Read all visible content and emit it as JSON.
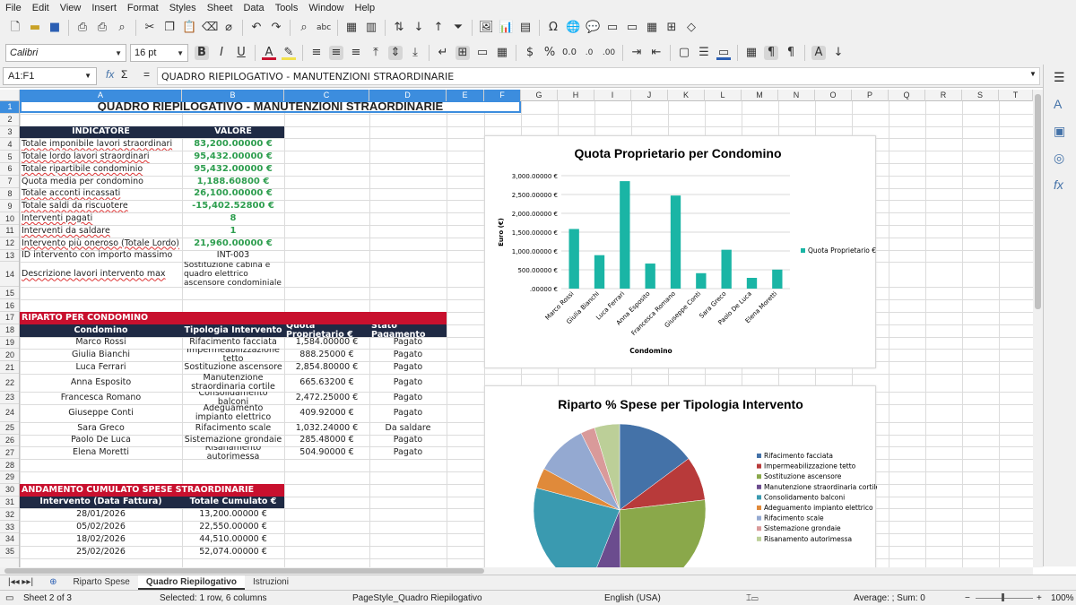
{
  "menu": [
    "File",
    "Edit",
    "View",
    "Insert",
    "Format",
    "Styles",
    "Sheet",
    "Data",
    "Tools",
    "Window",
    "Help"
  ],
  "toolbar": {
    "font_name": "Calibri",
    "font_size": "16 pt"
  },
  "formula_bar": {
    "name_box": "A1:F1",
    "content": "QUADRO RIEPILOGATIVO - MANUTENZIONI STRAORDINARIE",
    "fx": "fx",
    "sigma": "Σ",
    "eq": "="
  },
  "columns": [
    "A",
    "B",
    "C",
    "D",
    "E",
    "F",
    "G",
    "H",
    "I",
    "J",
    "K",
    "L",
    "M",
    "N",
    "O",
    "P",
    "Q",
    "R",
    "S",
    "T"
  ],
  "rows": [
    "1",
    "2",
    "3",
    "4",
    "5",
    "6",
    "7",
    "8",
    "9",
    "10",
    "11",
    "12",
    "13",
    "14",
    "15",
    "16",
    "17",
    "18",
    "19",
    "20",
    "21",
    "22",
    "23",
    "24",
    "25",
    "26",
    "27",
    "28",
    "29",
    "30",
    "31",
    "32",
    "33",
    "34",
    "35"
  ],
  "sheet": {
    "title": "QUADRO RIEPILOGATIVO - MANUTENZIONI STRAORDINARIE",
    "indicator_header": [
      "INDICATORE",
      "VALORE"
    ],
    "indicators": [
      {
        "label": "Totale imponibile lavori straordinari",
        "value": "83,200.00000 €"
      },
      {
        "label": "Totale lordo lavori straordinari",
        "value": "95,432.00000 €"
      },
      {
        "label": "Totale ripartibile condominio",
        "value": "95,432.00000 €"
      },
      {
        "label": "Quota media per condomino",
        "value": "1,188.60800 €"
      },
      {
        "label": "Totale acconti incassati",
        "value": "26,100.00000 €"
      },
      {
        "label": "Totale saldi da riscuotere",
        "value": "-15,402.52800 €"
      },
      {
        "label": "Interventi pagati",
        "value": "8"
      },
      {
        "label": "Interventi da saldare",
        "value": "1"
      },
      {
        "label": "Intervento più oneroso (Totale Lordo)",
        "value": "21,960.00000 €"
      },
      {
        "label": "ID intervento con importo massimo",
        "value": "INT-003"
      },
      {
        "label": "Descrizione lavori intervento max",
        "value": "Sostituzione cabina e quadro elettrico ascensore condominiale"
      }
    ],
    "riparto_title": "RIPARTO PER CONDOMINO",
    "riparto_header": [
      "Condomino",
      "Tipologia Intervento",
      "Quota Proprietario €",
      "Stato Pagamento"
    ],
    "riparto": [
      [
        "Marco Rossi",
        "Rifacimento facciata",
        "1,584.00000 €",
        "Pagato"
      ],
      [
        "Giulia Bianchi",
        "Impermeabilizzazione tetto",
        "888.25000 €",
        "Pagato"
      ],
      [
        "Luca Ferrari",
        "Sostituzione ascensore",
        "2,854.80000 €",
        "Pagato"
      ],
      [
        "Anna Esposito",
        "Manutenzione straordinaria cortile",
        "665.63200 €",
        "Pagato"
      ],
      [
        "Francesca Romano",
        "Consolidamento balconi",
        "2,472.25000 €",
        "Pagato"
      ],
      [
        "Giuseppe Conti",
        "Adeguamento impianto elettrico",
        "409.92000 €",
        "Pagato"
      ],
      [
        "Sara Greco",
        "Rifacimento scale",
        "1,032.24000 €",
        "Da saldare"
      ],
      [
        "Paolo De Luca",
        "Sistemazione grondaie",
        "285.48000 €",
        "Pagato"
      ],
      [
        "Elena Moretti",
        "Risanamento autorimessa",
        "504.90000 €",
        "Pagato"
      ]
    ],
    "cumulato_title": "ANDAMENTO CUMULATO SPESE STRAORDINARIE",
    "cumulato_header": [
      "Intervento (Data Fattura)",
      "Totale Cumulato €"
    ],
    "cumulato": [
      [
        "28/01/2026",
        "13,200.00000 €"
      ],
      [
        "05/02/2026",
        "22,550.00000 €"
      ],
      [
        "18/02/2026",
        "44,510.00000 €"
      ],
      [
        "25/02/2026",
        "52,074.00000 €"
      ]
    ]
  },
  "chart_data": [
    {
      "type": "bar",
      "title": "Quota Proprietario per Condomino",
      "xlabel": "Condomino",
      "ylabel": "Euro (€)",
      "ylim": [
        0,
        3000
      ],
      "yticks": [
        ".00000 €",
        "500.00000 €",
        "1,000.00000 €",
        "1,500.00000 €",
        "2,000.00000 €",
        "2,500.00000 €",
        "3,000.00000 €"
      ],
      "categories": [
        "Marco Rossi",
        "Giulia Bianchi",
        "Luca Ferrari",
        "Anna Esposito",
        "Francesca Romano",
        "Giuseppe Conti",
        "Sara Greco",
        "Paolo De Luca",
        "Elena Moretti"
      ],
      "series": [
        {
          "name": "Quota Proprietario €",
          "values": [
            1584,
            888.25,
            2854.8,
            665.632,
            2472.25,
            409.92,
            1032.24,
            285.48,
            504.9
          ],
          "color": "#1ab5a5"
        }
      ],
      "grid": true,
      "legend": "right"
    },
    {
      "type": "pie",
      "title": "Riparto % Spese per Tipologia Intervento",
      "categories": [
        "Rifacimento facciata",
        "Impermeabilizzazione tetto",
        "Sostituzione ascensore",
        "Manutenzione straordinaria cortile",
        "Consolidamento balconi",
        "Adeguamento impianto elettrico",
        "Rifacimento scale",
        "Sistemazione grondaie",
        "Risanamento autorimessa"
      ],
      "values": [
        1584,
        888.25,
        2854.8,
        665.632,
        2472.25,
        409.92,
        1032.24,
        285.48,
        504.9
      ],
      "colors": [
        "#4472a8",
        "#b83a3a",
        "#8aa84a",
        "#6b4c8e",
        "#3a9ab0",
        "#e08a3a",
        "#94a9d1",
        "#d99a9a",
        "#bccf98"
      ],
      "legend": "right"
    }
  ],
  "sheet_tabs": [
    "Riparto Spese",
    "Quadro Riepilogativo",
    "Istruzioni"
  ],
  "active_tab": "Quadro Riepilogativo",
  "status": {
    "sheet": "Sheet 2 of 3",
    "selection": "Selected: 1 row, 6 columns",
    "page_style": "PageStyle_Quadro Riepilogativo",
    "language": "English (USA)",
    "sum": "Average: ; Sum: 0",
    "zoom": "100%"
  }
}
